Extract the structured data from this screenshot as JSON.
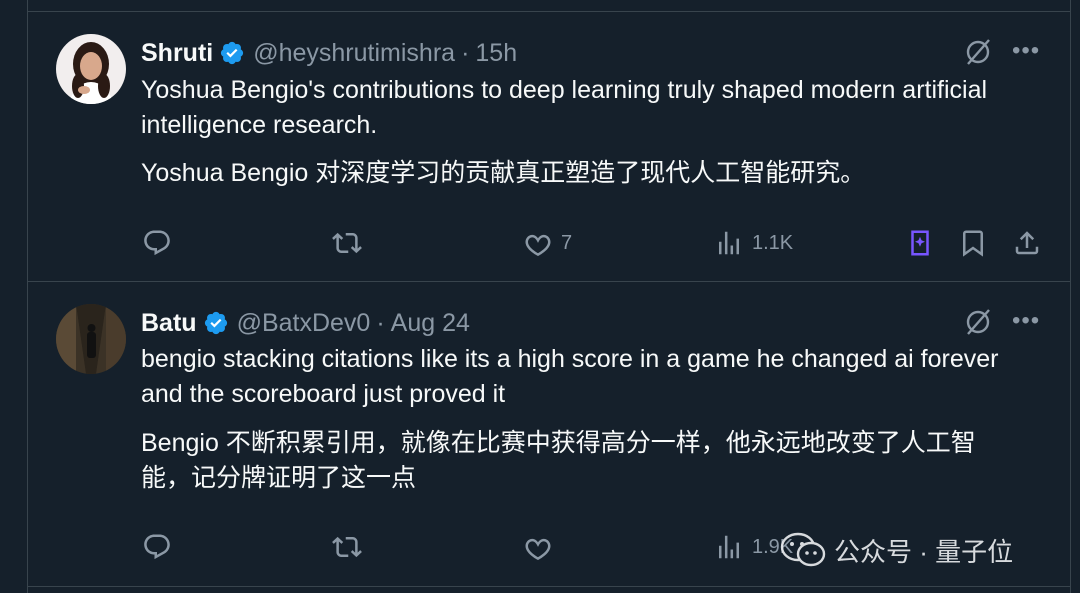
{
  "tweets": [
    {
      "name": "Shruti",
      "handle": "@heyshrutimishra",
      "separator": "·",
      "time": "15h",
      "text_en": "Yoshua Bengio's contributions to deep learning truly shaped modern artificial intelligence research.",
      "text_zh": "Yoshua Bengio 对深度学习的贡献真正塑造了现代人工智能研究。",
      "likes": "7",
      "views": "1.1K"
    },
    {
      "name": "Batu",
      "handle": "@BatxDev0",
      "separator": "·",
      "time": "Aug 24",
      "text_en": "bengio stacking citations like its a high score in a game he changed ai forever and the scoreboard just proved it",
      "text_zh": "Bengio 不断积累引用，就像在比赛中获得高分一样，他永远地改变了人工智能，记分牌证明了这一点",
      "likes": "",
      "views": "1.9K"
    }
  ],
  "more_glyph": "•••",
  "watermark": {
    "label": "公众号 · 量子位"
  },
  "icons": {
    "verified": "verified-badge-icon",
    "grok": "grok-icon",
    "reply": "reply-icon",
    "retweet": "retweet-icon",
    "like": "heart-icon",
    "views": "views-icon",
    "grok_analyze": "grok-analyze-icon",
    "bookmark": "bookmark-icon",
    "share": "share-icon"
  },
  "colors": {
    "background": "#15202b",
    "text": "#f7f9f9",
    "muted": "#8b98a5",
    "verified": "#1d9bf0",
    "grok_accent": "#7856ff",
    "divider": "#38444d"
  }
}
